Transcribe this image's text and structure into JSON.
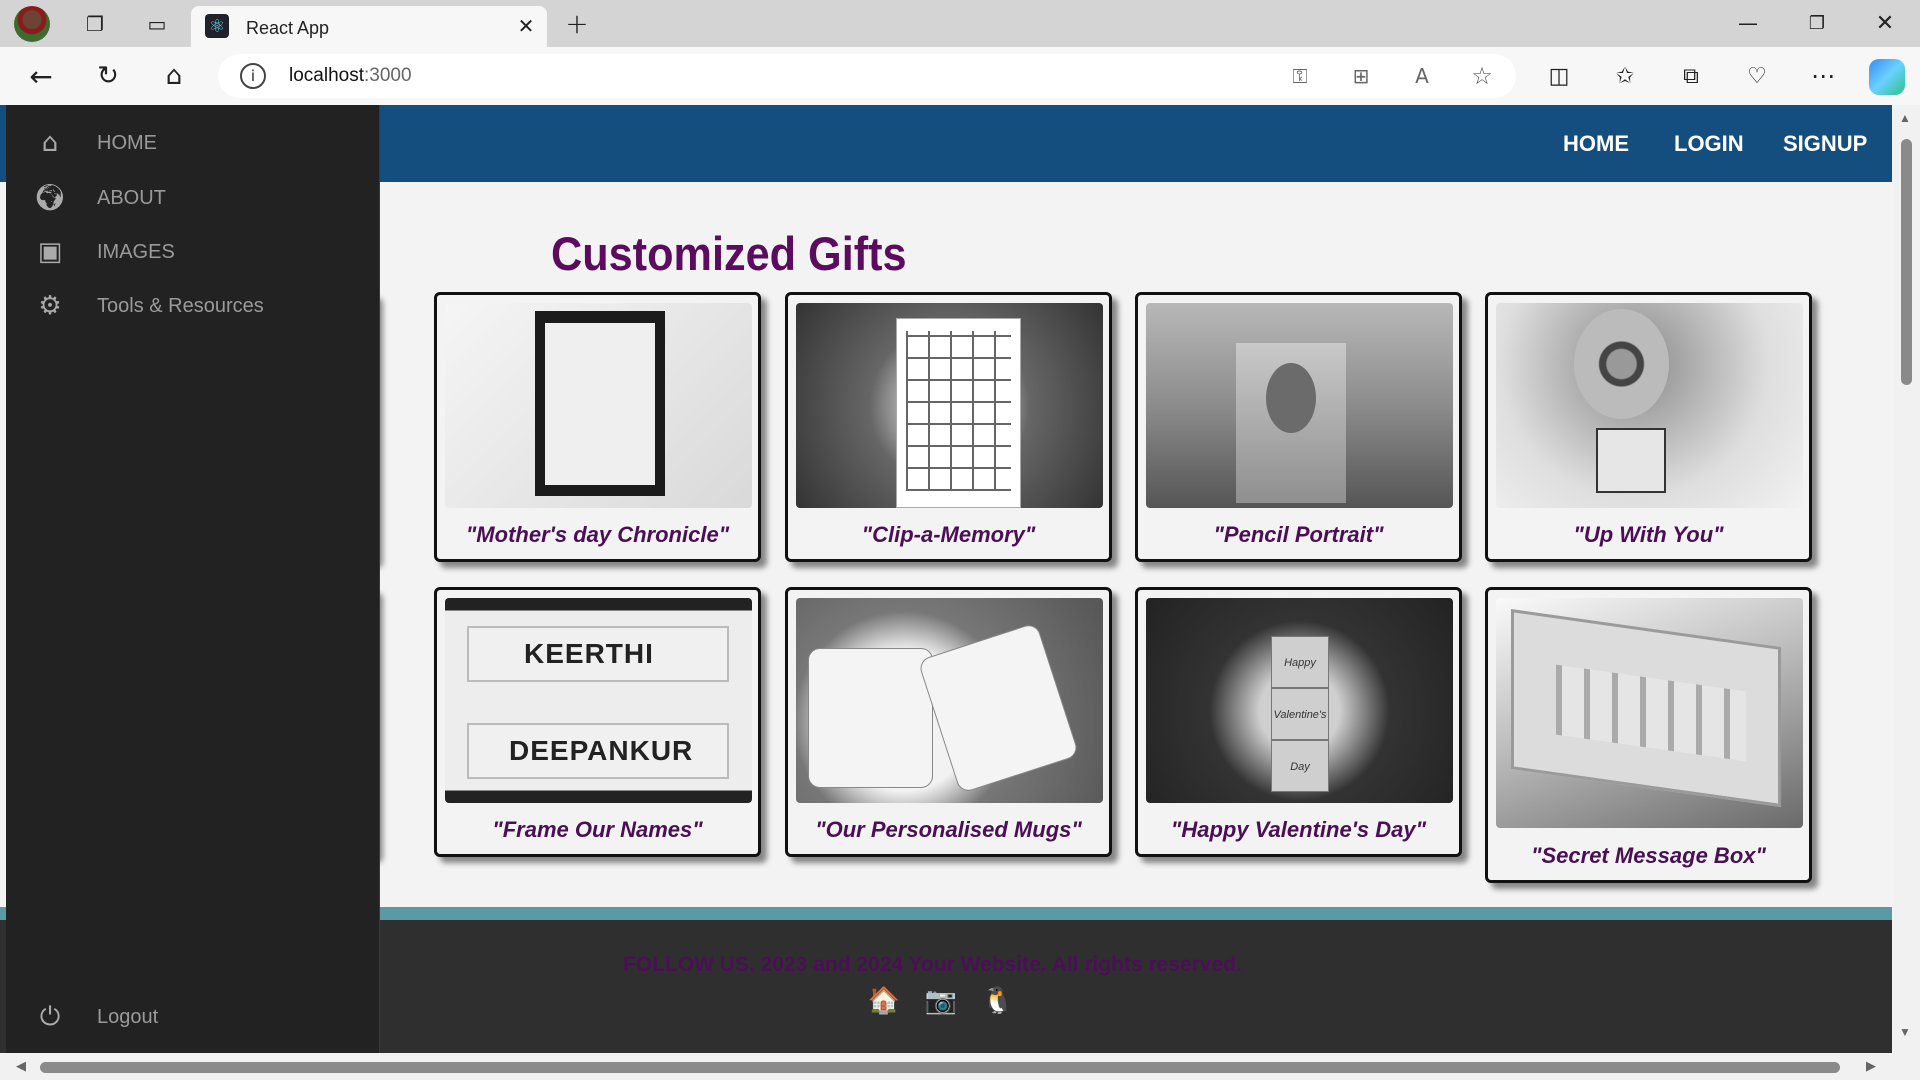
{
  "browser": {
    "tab_title": "React App",
    "url_host": "localhost",
    "url_port": ":3000"
  },
  "navbar": {
    "links": [
      "HOME",
      "LOGIN",
      "SIGNUP"
    ]
  },
  "sidebar": {
    "items": [
      {
        "label": "HOME",
        "icon": "home-icon"
      },
      {
        "label": "ABOUT",
        "icon": "globe-icon"
      },
      {
        "label": "IMAGES",
        "icon": "camera-icon"
      },
      {
        "label": "Tools & Resources",
        "icon": "gears-icon"
      }
    ],
    "logout_label": "Logout"
  },
  "main": {
    "heading": "Customized Gifts",
    "cards": [
      {
        "caption": "\"Mother's day Chronicle\""
      },
      {
        "caption": "\"Clip-a-Memory\""
      },
      {
        "caption": "\"Pencil Portrait\""
      },
      {
        "caption": "\"Up With You\""
      },
      {
        "caption": "\"Frame Our Names\""
      },
      {
        "caption": "\"Our Personalised Mugs\""
      },
      {
        "caption": "\"Happy Valentine's Day\""
      },
      {
        "caption": "\"Secret Message Box\""
      }
    ],
    "partial_card_caption": "\"",
    "image_texts": {
      "nameplate_top": "KEERTHI",
      "nameplate_bottom": "DEEPANKUR",
      "cube_1": "Happy",
      "cube_2": "Valentine's",
      "cube_3": "Day"
    }
  },
  "footer": {
    "text": "FOLLOW US. 2023 and 2024 Your Website. All rights reserved.",
    "social_icons": [
      "house-emoji-icon",
      "camera-emoji-icon",
      "penguin-emoji-icon"
    ]
  },
  "colors": {
    "navbar": "#134e7f",
    "sidebar": "#222222",
    "heading": "#5c0c5e",
    "divider": "#5b9aa5",
    "footer": "#2f2f2f"
  }
}
